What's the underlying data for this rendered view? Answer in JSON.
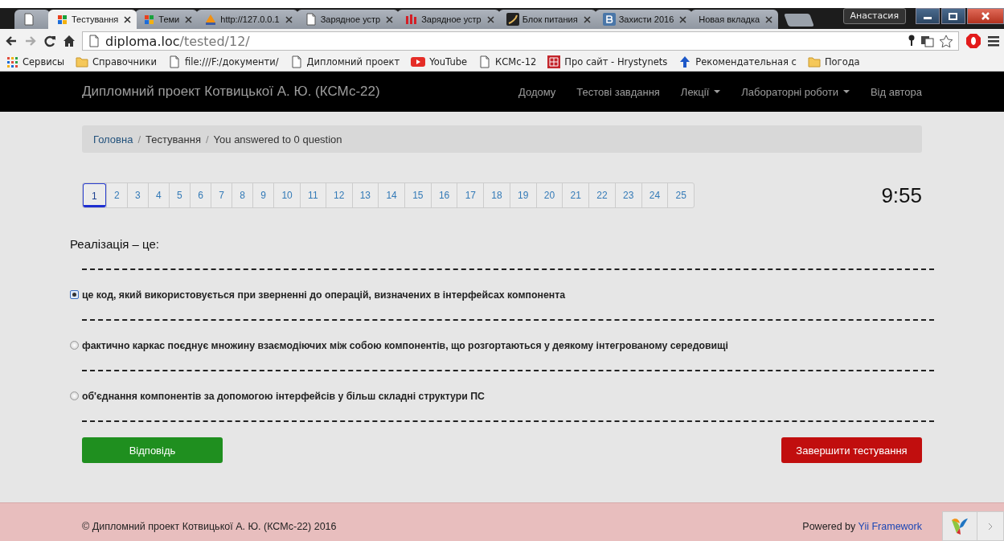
{
  "browser": {
    "tabs": [
      {
        "kind": "blank",
        "selected": false
      },
      {
        "label": "Тестування",
        "kind": "tiles",
        "selected": true
      },
      {
        "label": "Теми",
        "kind": "tiles",
        "selected": false
      },
      {
        "label": "http://127.0.0.1",
        "kind": "sail",
        "selected": false
      },
      {
        "label": "Зарядное устр",
        "kind": "doc",
        "selected": false
      },
      {
        "label": "Зарядное устр",
        "kind": "bars",
        "selected": false
      },
      {
        "label": "Блок питания",
        "kind": "swirl",
        "selected": false
      },
      {
        "label": "Захисти 2016",
        "kind": "social",
        "selected": false
      },
      {
        "label": "Новая вкладка",
        "kind": "plain",
        "selected": false
      }
    ],
    "user": "Анастасия",
    "address": {
      "host": "diploma.loc",
      "path": "/tested/12/"
    },
    "bookmarks": [
      {
        "label": "Сервисы",
        "kind": "apps"
      },
      {
        "label": "Справочники",
        "kind": "folder"
      },
      {
        "label": "file:///F:/документи/",
        "kind": "doc"
      },
      {
        "label": "Дипломний проект",
        "kind": "doc"
      },
      {
        "label": "YouTube",
        "kind": "video"
      },
      {
        "label": "КСМс-12",
        "kind": "doc"
      },
      {
        "label": "Про сайт - Hrystynets",
        "kind": "grid"
      },
      {
        "label": "Рекомендательная с",
        "kind": "arrow"
      },
      {
        "label": "Погода",
        "kind": "folder"
      }
    ]
  },
  "navbar": {
    "brand": "Дипломний проект Котвицької А. Ю. (КСМс-22)",
    "items": [
      {
        "label": "Додому",
        "dropdown": false
      },
      {
        "label": "Тестові завдання",
        "dropdown": false
      },
      {
        "label": "Лекції",
        "dropdown": true
      },
      {
        "label": "Лабораторні роботи",
        "dropdown": true
      },
      {
        "label": "Від автора",
        "dropdown": false
      }
    ]
  },
  "breadcrumb": [
    {
      "label": "Головна",
      "kind": "link"
    },
    {
      "label": "/",
      "kind": "separator"
    },
    {
      "label": "Тестування",
      "kind": "text"
    },
    {
      "label": "/",
      "kind": "separator"
    },
    {
      "label": "You answered to 0 question",
      "kind": "text"
    }
  ],
  "pagination": {
    "pages": [
      {
        "label": "1",
        "selected": true
      },
      {
        "label": "2",
        "selected": false
      },
      {
        "label": "3",
        "selected": false
      },
      {
        "label": "4",
        "selected": false
      },
      {
        "label": "5",
        "selected": false
      },
      {
        "label": "6",
        "selected": false
      },
      {
        "label": "7",
        "selected": false
      },
      {
        "label": "8",
        "selected": false
      },
      {
        "label": "9",
        "selected": false
      },
      {
        "label": "10",
        "selected": false
      },
      {
        "label": "11",
        "selected": false
      },
      {
        "label": "12",
        "selected": false
      },
      {
        "label": "13",
        "selected": false
      },
      {
        "label": "14",
        "selected": false
      },
      {
        "label": "15",
        "selected": false
      },
      {
        "label": "16",
        "selected": false
      },
      {
        "label": "17",
        "selected": false
      },
      {
        "label": "18",
        "selected": false
      },
      {
        "label": "19",
        "selected": false
      },
      {
        "label": "20",
        "selected": false
      },
      {
        "label": "21",
        "selected": false
      },
      {
        "label": "22",
        "selected": false
      },
      {
        "label": "23",
        "selected": false
      },
      {
        "label": "24",
        "selected": false
      },
      {
        "label": "25",
        "selected": false
      }
    ],
    "timer": "9:55"
  },
  "question": {
    "text": "Реалізація – це:",
    "options": [
      {
        "text": "це код, який використовується при зверненні до операцій, визначених в інтерфейсах компонента",
        "selected": true
      },
      {
        "text": "фактично каркас поєднує множину взаємодіючих між собою компонентів, що розгортаються у деякому інтегрованому середовищі",
        "selected": false
      },
      {
        "text": "об'єднання компонентів за допомогою інтерфейсів у більш складні структури ПС",
        "selected": false
      }
    ]
  },
  "buttons": {
    "answer": "Відповідь",
    "finish": "Завершити тестування"
  },
  "footer": {
    "copyright": "© Дипломний проект Котвицької А. Ю. (КСМс-22) 2016",
    "powered": "Powered by",
    "framework": "Yii Framework"
  }
}
